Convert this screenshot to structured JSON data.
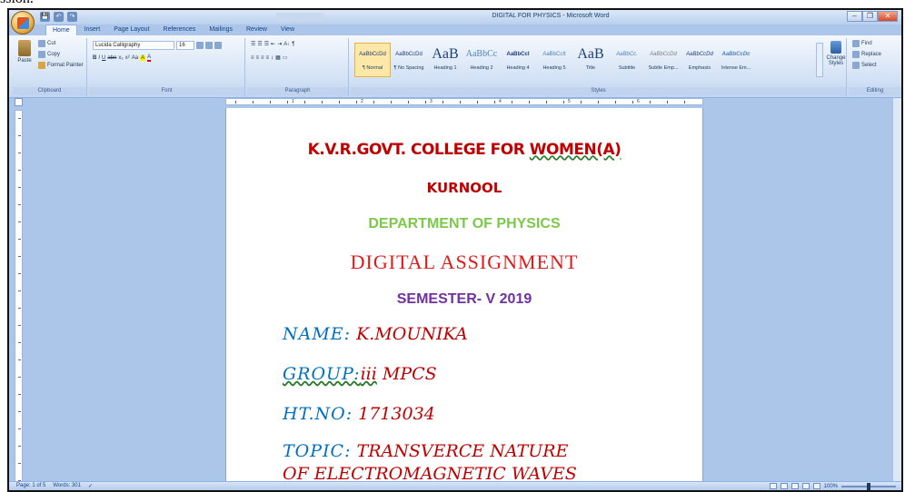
{
  "top_fragment": "ssion.",
  "window": {
    "title": "DIGITAL FOR PHYSICS - Microsoft Word",
    "controls": [
      "–",
      "❐",
      "✕"
    ]
  },
  "quick_access": [
    "💾",
    "↶",
    "↷"
  ],
  "tabs": [
    "Home",
    "Insert",
    "Page Layout",
    "References",
    "Mailings",
    "Review",
    "View"
  ],
  "ribbon": {
    "clipboard": {
      "label": "Clipboard",
      "paste": "Paste",
      "cut": "Cut",
      "copy": "Copy",
      "format_painter": "Format Painter"
    },
    "font": {
      "label": "Font",
      "font_name": "Lucida Calligraphy",
      "font_size": "16",
      "row2": [
        "B",
        "I",
        "U",
        "abe",
        "x₂",
        "x²",
        "Aa",
        "A",
        "A"
      ]
    },
    "paragraph": {
      "label": "Paragraph",
      "row1": [
        "☰",
        "☰",
        "☰",
        "⇤",
        "⇥",
        "A↓",
        "¶"
      ],
      "row2": [
        "≡",
        "≡",
        "≡",
        "≡",
        "↕",
        "▦",
        "▭"
      ]
    },
    "styles": {
      "label": "Styles",
      "items": [
        {
          "preview": "AaBbCcDd",
          "name": "¶ Normal",
          "selected": true,
          "size": "small"
        },
        {
          "preview": "AaBbCcDd",
          "name": "¶ No Spacing",
          "selected": false,
          "size": "small"
        },
        {
          "preview": "AaB",
          "name": "Heading 1",
          "selected": false,
          "size": "big"
        },
        {
          "preview": "AaBbCc",
          "name": "Heading 2",
          "selected": false,
          "size": "mid"
        },
        {
          "preview": "AaBbCcI",
          "name": "Heading 4",
          "selected": false,
          "size": "small"
        },
        {
          "preview": "AaBbCcIt",
          "name": "Heading 5",
          "selected": false,
          "size": "small"
        },
        {
          "preview": "AaB",
          "name": "Title",
          "selected": false,
          "size": "big"
        },
        {
          "preview": "AaBbCc.",
          "name": "Subtitle",
          "selected": false,
          "size": "small"
        },
        {
          "preview": "AaBbCcDd",
          "name": "Subtle Emp...",
          "selected": false,
          "size": "small"
        },
        {
          "preview": "AaBbCcDd",
          "name": "Emphasis",
          "selected": false,
          "size": "small"
        },
        {
          "preview": "AaBbCcDc",
          "name": "Intense Em...",
          "selected": false,
          "size": "small"
        }
      ],
      "change_styles": "Change Styles"
    },
    "editing": {
      "label": "Editing",
      "find": "Find",
      "replace": "Replace",
      "select": "Select"
    }
  },
  "ruler_numbers": [
    "1",
    "2",
    "3",
    "4",
    "5",
    "6"
  ],
  "document": {
    "college": "K.V.R.GOVT. COLLEGE FOR ",
    "college_wavy": "WOMEN(A)",
    "city": "KURNOOL",
    "department": "DEPARTMENT OF PHYSICS",
    "assignment": "DIGITAL ASSIGNMENT",
    "semester": "SEMESTER- V  2019",
    "name_label": "NAME:",
    "name_value": " K.MOUNIKA",
    "group_label": "GROUP:",
    "group_value_wavy": "iii",
    "group_value": " MPCS",
    "htno_label": "HT.NO:",
    "htno_value": " 1713034",
    "topic_label": "TOPIC:",
    "topic_line1": " TRANSVERCE NATURE",
    "topic_line2": "OF ELECTROMAGNETIC WAVES"
  },
  "statusbar": {
    "page": "Page: 1 of 5",
    "words": "Words: 301",
    "zoom": "100%"
  },
  "colors": {
    "college": "#c00000",
    "department": "#7cc94a",
    "assignment": "#e01a1a",
    "semester": "#7030a0",
    "field_label": "#0070c0",
    "field_value": "#c00000"
  }
}
